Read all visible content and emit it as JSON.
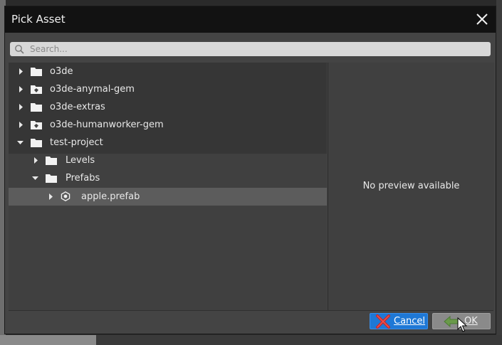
{
  "dialog": {
    "title": "Pick Asset"
  },
  "search": {
    "placeholder": "Search...",
    "value": ""
  },
  "tree": {
    "items": [
      {
        "label": "o3de",
        "icon": "folder-icon",
        "expanded": false,
        "level": 0
      },
      {
        "label": "o3de-anymal-gem",
        "icon": "gem-icon",
        "expanded": false,
        "level": 0
      },
      {
        "label": "o3de-extras",
        "icon": "folder-icon",
        "expanded": false,
        "level": 0
      },
      {
        "label": "o3de-humanworker-gem",
        "icon": "gem-icon",
        "expanded": false,
        "level": 0
      },
      {
        "label": "test-project",
        "icon": "folder-icon",
        "expanded": true,
        "level": 0
      },
      {
        "label": "Levels",
        "icon": "folder-icon",
        "expanded": false,
        "level": 1
      },
      {
        "label": "Prefabs",
        "icon": "folder-icon",
        "expanded": true,
        "level": 1
      },
      {
        "label": "apple.prefab",
        "icon": "prefab-icon",
        "expanded": false,
        "level": 2,
        "selected": true
      }
    ]
  },
  "preview": {
    "message": "No preview available"
  },
  "buttons": {
    "cancel_label": "Cancel",
    "ok_label": "OK"
  },
  "colors": {
    "titlebar": "#121212",
    "dialog_bg": "#444444",
    "cancel_blue": "#1e78d6",
    "selection": "#5c5c5c"
  }
}
